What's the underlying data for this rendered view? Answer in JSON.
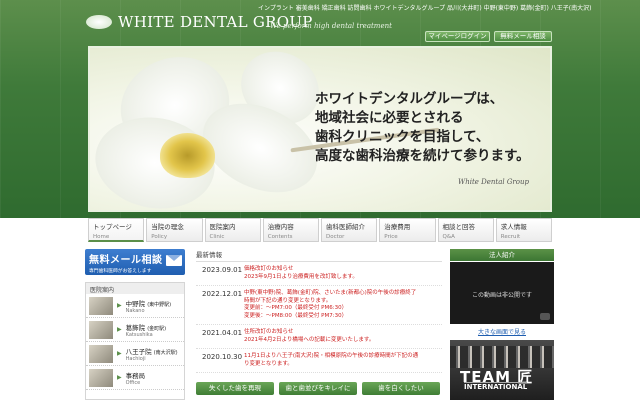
{
  "header": {
    "tagline": "インプラント 審美歯科 矯正歯科 訪問歯科 ホワイトデンタルグループ 品川(大井町) 中野(東中野) 葛飾(金町) 八王子(南大沢)",
    "logo": "WHITE DENTAL GROUP",
    "logo_sub": "We perform high dental treatment",
    "mypage_btn": "マイページログイン",
    "mail_btn": "無料メール相談"
  },
  "hero": {
    "line1": "ホワイトデンタルグループは、",
    "line2": "地域社会に必要とされる",
    "line3": "歯科クリニックを目指して、",
    "line4": "高度な歯科治療を続けて参ります。",
    "signature": "White Dental Group"
  },
  "nav": [
    {
      "jp": "トップページ",
      "en": "Home"
    },
    {
      "jp": "当院の理念",
      "en": "Policy"
    },
    {
      "jp": "医院案内",
      "en": "Clinic"
    },
    {
      "jp": "治療内容",
      "en": "Contents"
    },
    {
      "jp": "歯科医師紹介",
      "en": "Doctor"
    },
    {
      "jp": "治療費用",
      "en": "Price"
    },
    {
      "jp": "相談と回答",
      "en": "Q&A"
    },
    {
      "jp": "求人情報",
      "en": "Recruit"
    }
  ],
  "sidebar": {
    "mail_title": "無料メール相談",
    "mail_sub": "専門歯科医師がお答えします",
    "clinic_head": "医院案内",
    "clinics": [
      {
        "name": "中野院",
        "area": "(東中野駅)",
        "en": "Nakano"
      },
      {
        "name": "葛飾院",
        "area": "(金町駅)",
        "en": "Katsushika"
      },
      {
        "name": "八王子院",
        "area": "(南大沢駅)",
        "en": "Hachioji"
      },
      {
        "name": "事務局",
        "area": "",
        "en": "Office"
      }
    ]
  },
  "news": {
    "head": "最新情報",
    "items": [
      {
        "date": "2023.09.01",
        "lines": [
          "価格改訂のお知らせ",
          "2023年9月1日より治療費用を改訂致します。"
        ]
      },
      {
        "date": "2022.12.01",
        "lines": [
          "中野(東中野)院、葛飾(金町)院、さいたま(新都心)院の午後の診療終了",
          "時間が下記の通り変更となります。",
          "変更前：～PM7:00（最終受付 PM6:30）",
          "変更後：～PM8:00（最終受付 PM7:30）"
        ]
      },
      {
        "date": "2021.04.01",
        "lines": [
          "住所改訂のお知らせ",
          "2021年4月2日より橋場への記載に変更いたします。"
        ]
      },
      {
        "date": "2020.10.30",
        "lines": [
          "11月1日より八王子(南大沢)院・相模原院の午後の診療時間が下記の通",
          "り変更となります。"
        ]
      }
    ]
  },
  "bottom_buttons": [
    "失くした歯を再現",
    "歯と歯並びをキレイに",
    "歯を白くしたい"
  ],
  "right": {
    "title": "法人紹介",
    "video_msg": "この動画は非公開です",
    "video_link": "大きな画面で見る",
    "team_name": "TEAM 匠",
    "team_sub": "INTERNATIONAL"
  }
}
